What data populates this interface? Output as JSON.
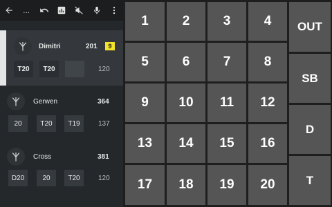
{
  "toolbar": {
    "icons": [
      "back-arrow-icon",
      "more-horiz-icon",
      "undo-icon",
      "stats-icon",
      "mute-icon",
      "mic-icon",
      "more-vert-icon"
    ],
    "ellipsis": "..."
  },
  "players": [
    {
      "name": "Dimitri",
      "score": "201",
      "badge": "9",
      "throws": [
        "T20",
        "T20",
        ""
      ],
      "total": "120",
      "active": true
    },
    {
      "name": "Gerwen",
      "score": "364",
      "throws": [
        "20",
        "T20",
        "T19"
      ],
      "total": "137",
      "active": false
    },
    {
      "name": "Cross",
      "score": "381",
      "throws": [
        "D20",
        "20",
        "T20"
      ],
      "total": "120",
      "active": false
    }
  ],
  "keypad": {
    "numbers": [
      "1",
      "2",
      "3",
      "4",
      "5",
      "6",
      "7",
      "8",
      "9",
      "10",
      "11",
      "12",
      "13",
      "14",
      "15",
      "16",
      "17",
      "18",
      "19",
      "20"
    ],
    "side": [
      "OUT",
      "SB",
      "D",
      "T"
    ]
  },
  "colors": {
    "key_bg": "#555555",
    "active_row": "#34383c",
    "badge": "#f2e22a"
  }
}
